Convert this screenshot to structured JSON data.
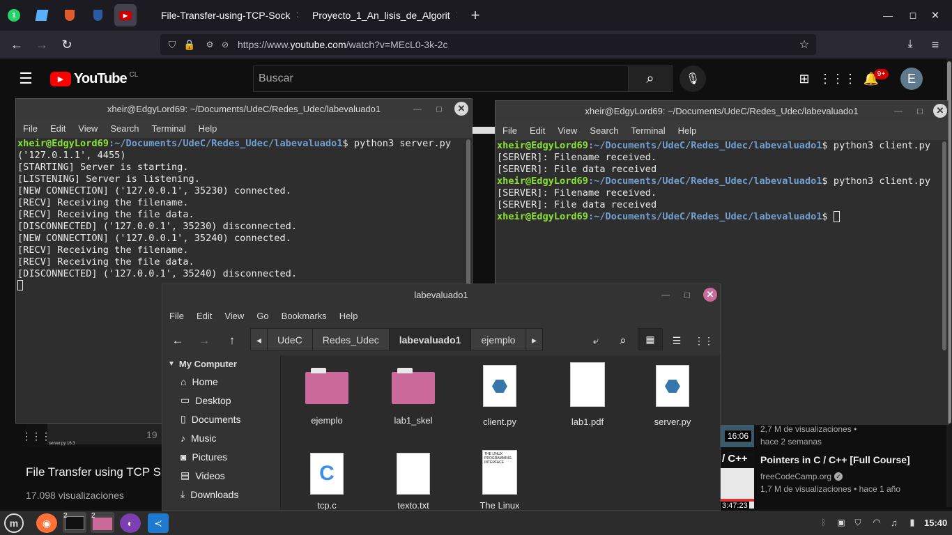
{
  "browser": {
    "pinned_tabs": [
      {
        "icon": "whatsapp-icon",
        "color": "#25d366"
      },
      {
        "icon": "canvas-icon",
        "color": "#58b0ff"
      },
      {
        "icon": "crest-icon",
        "color": "#e05a2a"
      },
      {
        "icon": "bitwarden-icon",
        "color": "#2c5aa0"
      },
      {
        "icon": "youtube-audio-icon",
        "color": "#cc0000"
      }
    ],
    "tabs": [
      {
        "title": "File-Transfer-using-TCP-Sock",
        "icon": "github-icon"
      },
      {
        "title": "Proyecto_1_An_lisis_de_Algorit",
        "icon": "doc-icon"
      }
    ],
    "new_tab": "+",
    "url_prefix": "https://www.",
    "url_domain": "youtube.com",
    "url_path": "/watch?v=MEcL0-3k-2c"
  },
  "youtube": {
    "logo": "YouTube",
    "region": "CL",
    "search_placeholder": "Buscar",
    "notif_count": "9+",
    "avatar_letter": "E",
    "video_title": "File Transfer using TCP S",
    "video_views": "17.098 visualizaciones",
    "player_small_text": "server.py    16:3",
    "player_time": "19",
    "rec1_duration": "16:06",
    "rec1_meta1": "2,7 M de visualizaciones •",
    "rec1_meta2": "hace 2 semanas",
    "rec2_title": "Pointers in C / C++ [Full Course]",
    "rec2_channel": "freeCodeCamp.org",
    "rec2_meta": "1,7 M de visualizaciones • hace 1 año",
    "rec2_thumb_text": "/ C++",
    "rec2_duration": "3:47:23"
  },
  "term1": {
    "title": "xheir@EdgyLord69: ~/Documents/UdeC/Redes_Udec/labevaluado1",
    "menu": [
      "File",
      "Edit",
      "View",
      "Search",
      "Terminal",
      "Help"
    ],
    "prompt_user": "xheir@EdgyLord69",
    "prompt_path": "~/Documents/UdeC/Redes_Udec/labevaluado1",
    "command": " python3 server.py",
    "lines": [
      "('127.0.1.1', 4455)",
      "[STARTING] Server is starting.",
      "[LISTENING] Server is listening.",
      "[NEW CONNECTION] ('127.0.0.1', 35230) connected.",
      "[RECV] Receiving the filename.",
      "[RECV] Receiving the file data.",
      "[DISCONNECTED] ('127.0.0.1', 35230) disconnected.",
      "[NEW CONNECTION] ('127.0.0.1', 35240) connected.",
      "[RECV] Receiving the filename.",
      "[RECV] Receiving the file data.",
      "[DISCONNECTED] ('127.0.0.1', 35240) disconnected."
    ]
  },
  "term2": {
    "title": "xheir@EdgyLord69: ~/Documents/UdeC/Redes_Udec/labevaluado1",
    "menu": [
      "File",
      "Edit",
      "View",
      "Search",
      "Terminal",
      "Help"
    ],
    "prompt_user": "xheir@EdgyLord69",
    "prompt_path": "~/Documents/UdeC/Redes_Udec/labevaluado1",
    "command": " python3 client.py",
    "out1": "[SERVER]: Filename received.",
    "out2": "[SERVER]: File data received"
  },
  "files": {
    "title": "labevaluado1",
    "menu": [
      "File",
      "Edit",
      "View",
      "Go",
      "Bookmarks",
      "Help"
    ],
    "crumbs": [
      "UdeC",
      "Redes_Udec",
      "labevaluado1",
      "ejemplo"
    ],
    "sidebar_header": "My Computer",
    "sidebar": [
      {
        "label": "Home",
        "icon": "home-icon"
      },
      {
        "label": "Desktop",
        "icon": "desktop-icon"
      },
      {
        "label": "Documents",
        "icon": "documents-icon"
      },
      {
        "label": "Music",
        "icon": "music-icon"
      },
      {
        "label": "Pictures",
        "icon": "pictures-icon"
      },
      {
        "label": "Videos",
        "icon": "videos-icon"
      },
      {
        "label": "Downloads",
        "icon": "downloads-icon"
      }
    ],
    "items": [
      {
        "name": "ejemplo",
        "kind": "folder"
      },
      {
        "name": "lab1_skel",
        "kind": "folder"
      },
      {
        "name": "client.py",
        "kind": "python"
      },
      {
        "name": "lab1.pdf",
        "kind": "pdf"
      },
      {
        "name": "server.py",
        "kind": "python"
      },
      {
        "name": "tcp.c",
        "kind": "c"
      },
      {
        "name": "texto.txt",
        "kind": "txt"
      },
      {
        "name": "The Linux",
        "kind": "book"
      }
    ],
    "book_cover_text": "THE LINUX PROGRAMMING INTERFACE"
  },
  "taskbar": {
    "terminal_count": "2",
    "files_count": "2",
    "clock": "15:40"
  }
}
